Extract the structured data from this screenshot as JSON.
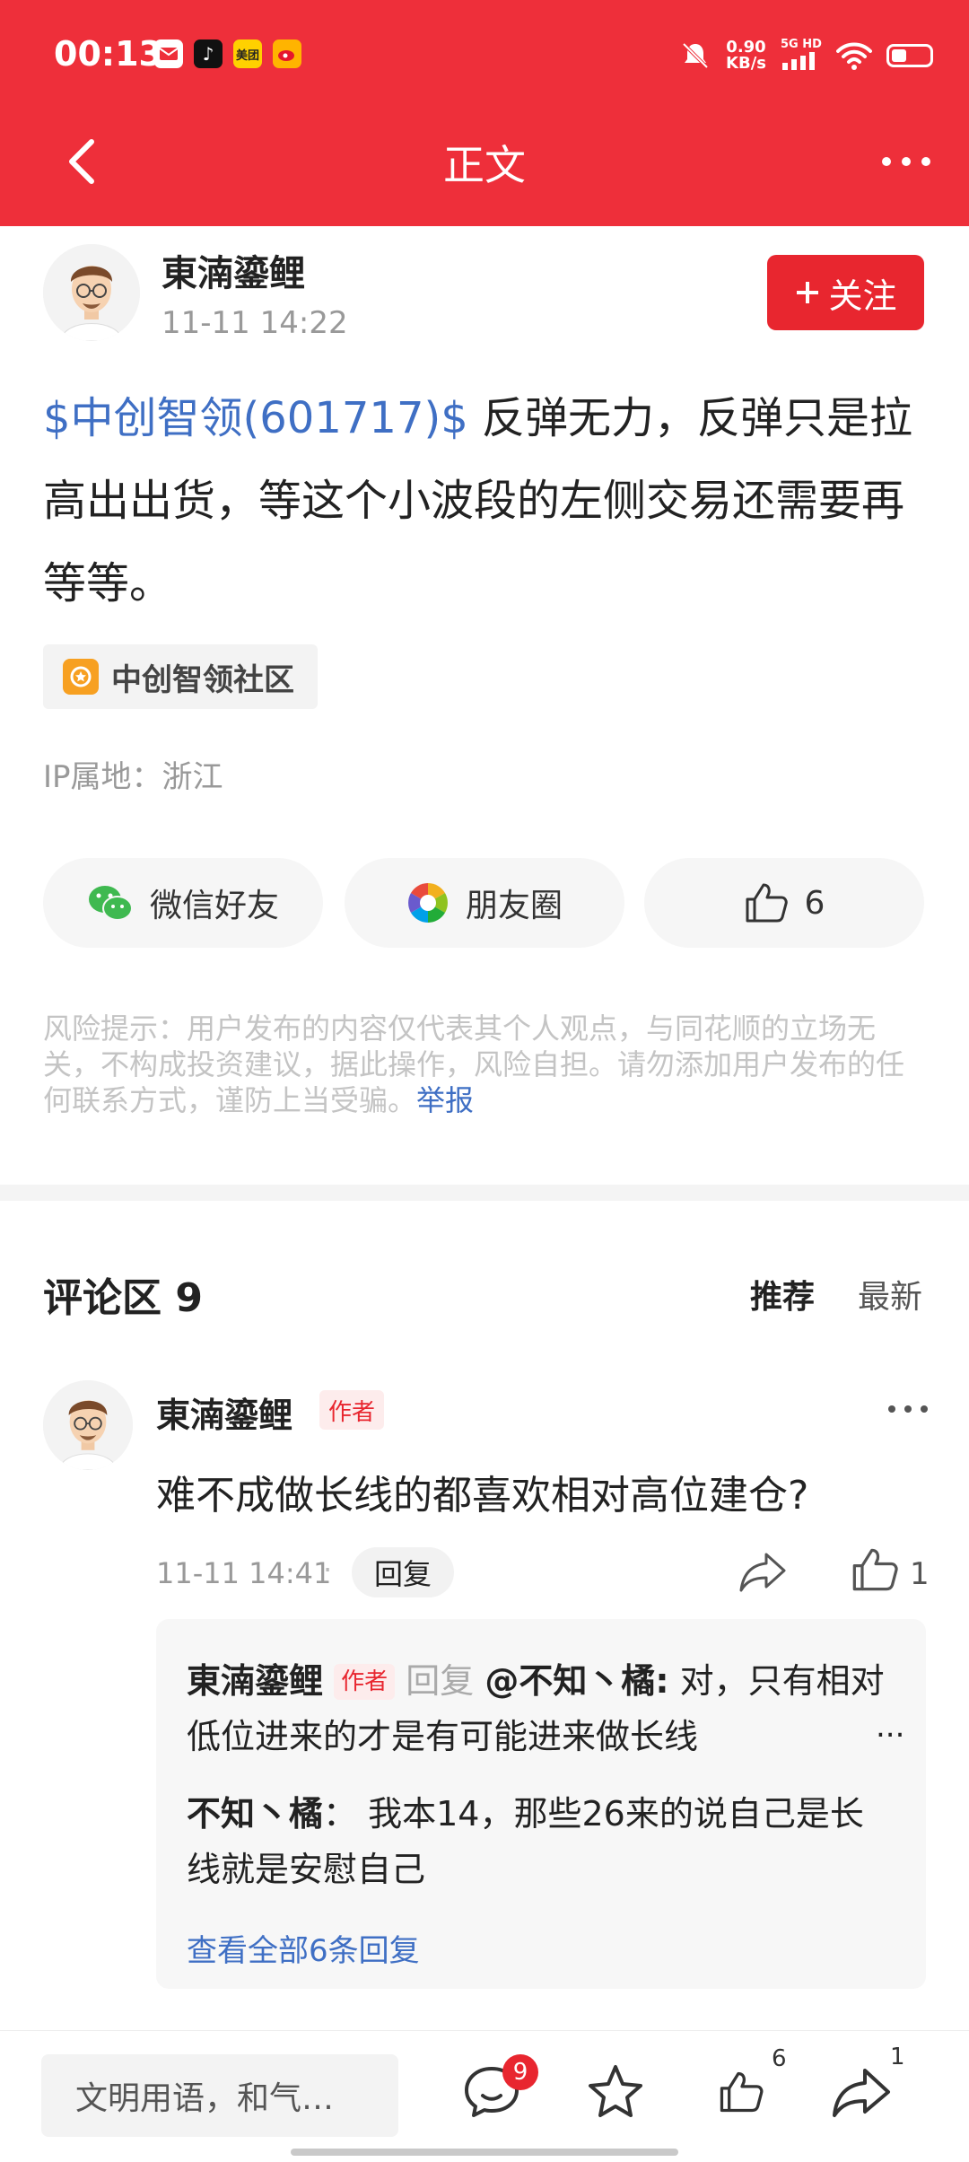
{
  "status_bar": {
    "time": "00:13",
    "app_icons": [
      "mail-icon",
      "tiktok-icon",
      "meituan-icon",
      "weibo-icon"
    ],
    "meituan_label": "美团",
    "net_speed_value": "0.90",
    "net_speed_unit": "KB/s",
    "signal_label": "5G HD",
    "icons": [
      "mute-icon",
      "signal-icon",
      "wifi-icon",
      "battery-icon"
    ]
  },
  "nav": {
    "title": "正文"
  },
  "post": {
    "author": "東湳鎏鲤",
    "time": "11-11 14:22",
    "follow_label": "关注",
    "stock_link": "$中创智领(601717)$",
    "body_text": " 反弹无力，反弹只是拉高出出货，等这个小波段的左侧交易还需要再等等。",
    "topic": "中创智领社区",
    "ip_location": "IP属地：浙江"
  },
  "share": {
    "wechat_label": "微信好友",
    "moments_label": "朋友圈",
    "like_count": "6"
  },
  "risk": {
    "text": "风险提示：用户发布的内容仅代表其个人观点，与同花顺的立场无关，不构成投资建议，据此操作，风险自担。请勿添加用户发布的任何联系方式，谨防上当受骗。",
    "report_label": "举报"
  },
  "comments": {
    "title": "评论区 9",
    "sort_recommended": "推荐",
    "sort_latest": "最新",
    "items": [
      {
        "author": "東湳鎏鲤",
        "badge": "作者",
        "text": "难不成做长线的都喜欢相对高位建仓?",
        "time": "11-11 14:41",
        "dot": "·",
        "reply_label": "回复",
        "like_count": "1",
        "replies": [
          {
            "author": "東湳鎏鲤",
            "badge": "作者",
            "reply_word": "回复",
            "target": "@不知丶橘:",
            "text": "对，只有相对低位进来的才是有可能进来做长线",
            "ellipsis": "..."
          },
          {
            "author": "不知丶橘",
            "separator": "：",
            "text": "我本14，那些26来的说自己是长线就是安慰自己"
          }
        ],
        "view_all": "查看全部6条回复"
      }
    ]
  },
  "bottom_bar": {
    "input_placeholder": "文明用语，和气…",
    "message_badge": "9",
    "like_count": "6",
    "share_count": "1"
  },
  "colors": {
    "brand_red": "#ee2f3a",
    "button_red": "#e8262f",
    "link_blue": "#3f6fc4"
  }
}
